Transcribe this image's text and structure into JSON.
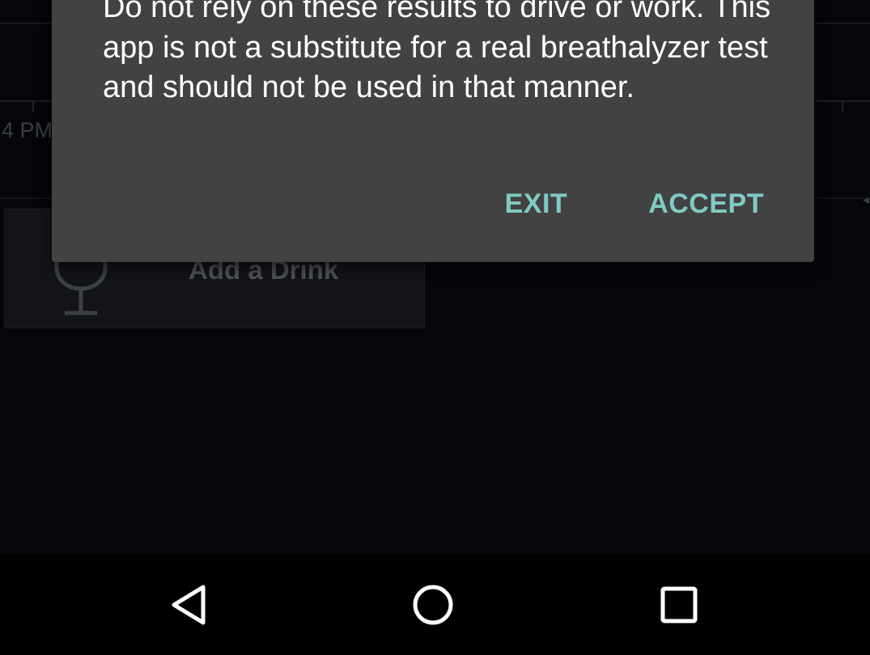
{
  "background_app": {
    "time_label": "4 PM",
    "add_drink_label": "Add a Drink",
    "glass_icon": "wine-glass-icon"
  },
  "dialog": {
    "message": "Do not rely on these results to drive or work. This app is not a substitute for a real breathalyzer test and should not be used in that manner.",
    "exit_label": "EXIT",
    "accept_label": "ACCEPT",
    "button_color": "#80cbc4",
    "background_color": "#424242"
  },
  "navbar": {
    "back_icon": "back-triangle-icon",
    "home_icon": "home-circle-icon",
    "recent_icon": "recent-apps-square-icon"
  }
}
